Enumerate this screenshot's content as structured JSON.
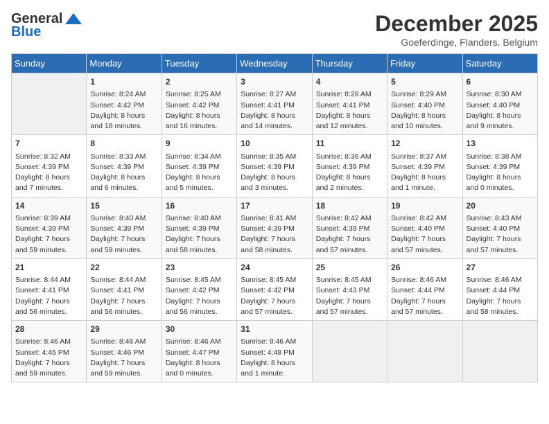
{
  "header": {
    "logo_line1": "General",
    "logo_line2": "Blue",
    "month": "December 2025",
    "location": "Goeferdinge, Flanders, Belgium"
  },
  "days_of_week": [
    "Sunday",
    "Monday",
    "Tuesday",
    "Wednesday",
    "Thursday",
    "Friday",
    "Saturday"
  ],
  "weeks": [
    [
      {
        "day": "",
        "info": ""
      },
      {
        "day": "1",
        "info": "Sunrise: 8:24 AM\nSunset: 4:42 PM\nDaylight: 8 hours\nand 18 minutes."
      },
      {
        "day": "2",
        "info": "Sunrise: 8:25 AM\nSunset: 4:42 PM\nDaylight: 8 hours\nand 16 minutes."
      },
      {
        "day": "3",
        "info": "Sunrise: 8:27 AM\nSunset: 4:41 PM\nDaylight: 8 hours\nand 14 minutes."
      },
      {
        "day": "4",
        "info": "Sunrise: 8:28 AM\nSunset: 4:41 PM\nDaylight: 8 hours\nand 12 minutes."
      },
      {
        "day": "5",
        "info": "Sunrise: 8:29 AM\nSunset: 4:40 PM\nDaylight: 8 hours\nand 10 minutes."
      },
      {
        "day": "6",
        "info": "Sunrise: 8:30 AM\nSunset: 4:40 PM\nDaylight: 8 hours\nand 9 minutes."
      }
    ],
    [
      {
        "day": "7",
        "info": "Sunrise: 8:32 AM\nSunset: 4:39 PM\nDaylight: 8 hours\nand 7 minutes."
      },
      {
        "day": "8",
        "info": "Sunrise: 8:33 AM\nSunset: 4:39 PM\nDaylight: 8 hours\nand 6 minutes."
      },
      {
        "day": "9",
        "info": "Sunrise: 8:34 AM\nSunset: 4:39 PM\nDaylight: 8 hours\nand 5 minutes."
      },
      {
        "day": "10",
        "info": "Sunrise: 8:35 AM\nSunset: 4:39 PM\nDaylight: 8 hours\nand 3 minutes."
      },
      {
        "day": "11",
        "info": "Sunrise: 8:36 AM\nSunset: 4:39 PM\nDaylight: 8 hours\nand 2 minutes."
      },
      {
        "day": "12",
        "info": "Sunrise: 8:37 AM\nSunset: 4:39 PM\nDaylight: 8 hours\nand 1 minute."
      },
      {
        "day": "13",
        "info": "Sunrise: 8:38 AM\nSunset: 4:39 PM\nDaylight: 8 hours\nand 0 minutes."
      }
    ],
    [
      {
        "day": "14",
        "info": "Sunrise: 8:39 AM\nSunset: 4:39 PM\nDaylight: 7 hours\nand 59 minutes."
      },
      {
        "day": "15",
        "info": "Sunrise: 8:40 AM\nSunset: 4:39 PM\nDaylight: 7 hours\nand 59 minutes."
      },
      {
        "day": "16",
        "info": "Sunrise: 8:40 AM\nSunset: 4:39 PM\nDaylight: 7 hours\nand 58 minutes."
      },
      {
        "day": "17",
        "info": "Sunrise: 8:41 AM\nSunset: 4:39 PM\nDaylight: 7 hours\nand 58 minutes."
      },
      {
        "day": "18",
        "info": "Sunrise: 8:42 AM\nSunset: 4:39 PM\nDaylight: 7 hours\nand 57 minutes."
      },
      {
        "day": "19",
        "info": "Sunrise: 8:42 AM\nSunset: 4:40 PM\nDaylight: 7 hours\nand 57 minutes."
      },
      {
        "day": "20",
        "info": "Sunrise: 8:43 AM\nSunset: 4:40 PM\nDaylight: 7 hours\nand 57 minutes."
      }
    ],
    [
      {
        "day": "21",
        "info": "Sunrise: 8:44 AM\nSunset: 4:41 PM\nDaylight: 7 hours\nand 56 minutes."
      },
      {
        "day": "22",
        "info": "Sunrise: 8:44 AM\nSunset: 4:41 PM\nDaylight: 7 hours\nand 56 minutes."
      },
      {
        "day": "23",
        "info": "Sunrise: 8:45 AM\nSunset: 4:42 PM\nDaylight: 7 hours\nand 56 minutes."
      },
      {
        "day": "24",
        "info": "Sunrise: 8:45 AM\nSunset: 4:42 PM\nDaylight: 7 hours\nand 57 minutes."
      },
      {
        "day": "25",
        "info": "Sunrise: 8:45 AM\nSunset: 4:43 PM\nDaylight: 7 hours\nand 57 minutes."
      },
      {
        "day": "26",
        "info": "Sunrise: 8:46 AM\nSunset: 4:44 PM\nDaylight: 7 hours\nand 57 minutes."
      },
      {
        "day": "27",
        "info": "Sunrise: 8:46 AM\nSunset: 4:44 PM\nDaylight: 7 hours\nand 58 minutes."
      }
    ],
    [
      {
        "day": "28",
        "info": "Sunrise: 8:46 AM\nSunset: 4:45 PM\nDaylight: 7 hours\nand 59 minutes."
      },
      {
        "day": "29",
        "info": "Sunrise: 8:46 AM\nSunset: 4:46 PM\nDaylight: 7 hours\nand 59 minutes."
      },
      {
        "day": "30",
        "info": "Sunrise: 8:46 AM\nSunset: 4:47 PM\nDaylight: 8 hours\nand 0 minutes."
      },
      {
        "day": "31",
        "info": "Sunrise: 8:46 AM\nSunset: 4:48 PM\nDaylight: 8 hours\nand 1 minute."
      },
      {
        "day": "",
        "info": ""
      },
      {
        "day": "",
        "info": ""
      },
      {
        "day": "",
        "info": ""
      }
    ]
  ]
}
